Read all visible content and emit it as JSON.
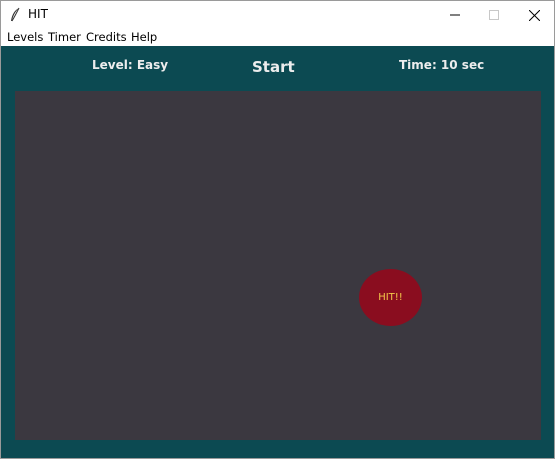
{
  "window": {
    "title": "HIT",
    "app_icon": "feather-icon",
    "controls": [
      "minimize-icon",
      "maximize-icon",
      "close-icon"
    ]
  },
  "menu": {
    "items": [
      {
        "label": "Levels"
      },
      {
        "label": "Timer"
      },
      {
        "label": "Credits"
      },
      {
        "label": "Help"
      }
    ]
  },
  "hud": {
    "level": "Level: Easy",
    "start": "Start",
    "time": "Time: 10 sec"
  },
  "target": {
    "label": "HIT!!"
  },
  "colors": {
    "background": "#0c4a52",
    "arena": "#3b3840",
    "target": "#8a0d1f",
    "target_text": "#f2c84a",
    "hud_text": "#ededed"
  }
}
